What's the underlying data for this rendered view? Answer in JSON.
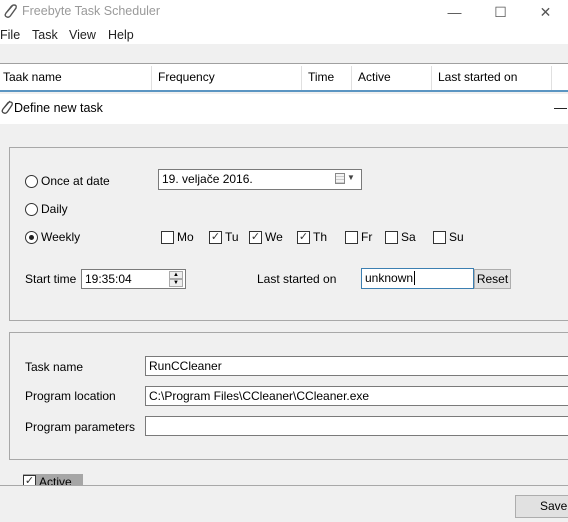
{
  "window": {
    "title": "Freebyte Task Scheduler",
    "minimize_label": "—",
    "maximize_label": "☐",
    "close_label": "✕"
  },
  "menu": [
    "File",
    "Task",
    "View",
    "Help"
  ],
  "task_list": {
    "columns": [
      "Taak name",
      "Frequency",
      "Time",
      "Active",
      "Last started on"
    ]
  },
  "dialog": {
    "title": "Define new task",
    "collapse_label": "—",
    "schedule": {
      "options": [
        {
          "label": "Once at date",
          "selected": false
        },
        {
          "label": "Daily",
          "selected": false
        },
        {
          "label": "Weekly",
          "selected": true
        }
      ],
      "date_value": "19.  veljače  2016.",
      "days": [
        {
          "label": "Mo",
          "checked": false
        },
        {
          "label": "Tu",
          "checked": true
        },
        {
          "label": "We",
          "checked": true
        },
        {
          "label": "Th",
          "checked": true
        },
        {
          "label": "Fr",
          "checked": false
        },
        {
          "label": "Sa",
          "checked": false
        },
        {
          "label": "Su",
          "checked": false
        }
      ],
      "start_time_label": "Start time",
      "start_time_value": "19:35:04",
      "last_started_label": "Last started on",
      "last_started_value": "unknown",
      "reset_label": "Reset"
    },
    "program": {
      "task_name_label": "Task name",
      "task_name_value": "RunCCleaner",
      "location_label": "Program location",
      "location_value": "C:\\Program Files\\CCleaner\\CCleaner.exe",
      "params_label": "Program parameters",
      "params_value": ""
    },
    "active_label": "Active",
    "active_checked": true,
    "save_label": "Save"
  }
}
